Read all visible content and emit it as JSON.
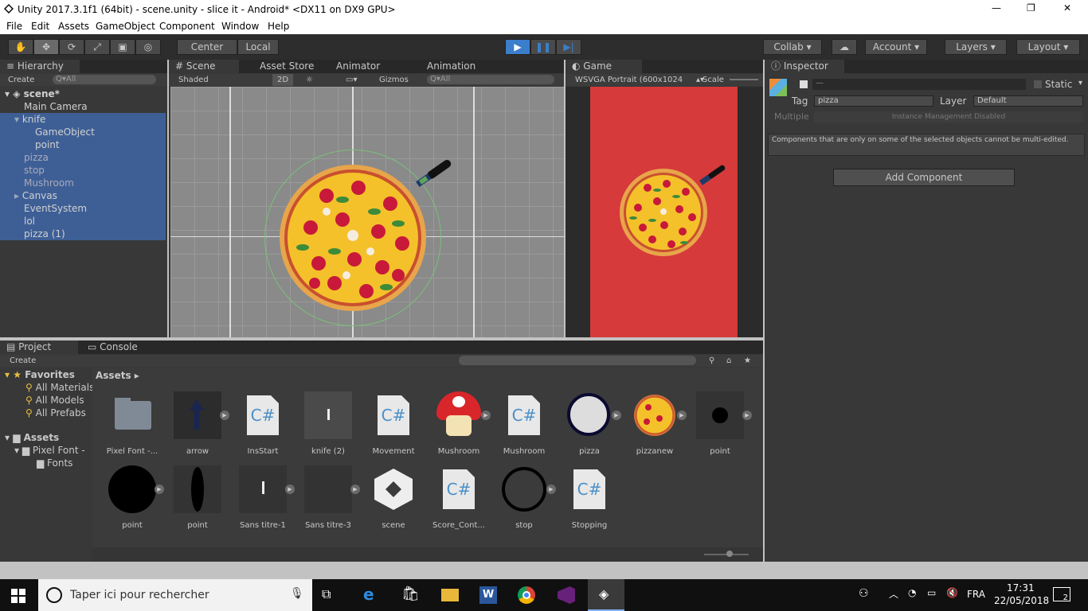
{
  "window": {
    "title": "Unity 2017.3.1f1 (64bit) - scene.unity - slice it - Android* <DX11 on DX9 GPU>",
    "minimize": "—",
    "restore": "❐",
    "close": "✕"
  },
  "menu": [
    "File",
    "Edit",
    "Assets",
    "GameObject",
    "Component",
    "Window",
    "Help"
  ],
  "toolbar": {
    "center": "Center",
    "local": "Local",
    "collab": "Collab",
    "account": "Account",
    "layers": "Layers",
    "layout": "Layout"
  },
  "hierarchy": {
    "tab": "Hierarchy",
    "create": "Create",
    "search": "Q▾All",
    "scene": "scene*",
    "items": [
      "Main Camera",
      "knife",
      "GameObject",
      "point",
      "pizza",
      "stop",
      "Mushroom",
      "Canvas",
      "EventSystem",
      "lol",
      "pizza (1)"
    ]
  },
  "scene_tabs": [
    "Scene",
    "Asset Store",
    "Animator",
    "Animation"
  ],
  "scene_bar": {
    "shaded": "Shaded",
    "mode2d": "2D",
    "gizmos": "Gizmos",
    "search": "Q▾All"
  },
  "game": {
    "tab": "Game",
    "resolution": "WSVGA Portrait (600x1024",
    "scale": "Scale"
  },
  "inspector": {
    "tab": "Inspector",
    "name": "—",
    "static": "Static",
    "tag_label": "Tag",
    "tag_value": "pizza",
    "layer_label": "Layer",
    "layer_value": "Default",
    "multiple": "Multiple",
    "instance": "Instance Management Disabled",
    "note": "Components that are only on some of the selected objects cannot be multi-edited.",
    "add": "Add Component"
  },
  "bottom_tabs": [
    "Project",
    "Console"
  ],
  "project": {
    "create": "Create",
    "favorites": "Favorites",
    "fav_items": [
      "All Materials",
      "All Models",
      "All Prefabs"
    ],
    "assets": "Assets",
    "tree": [
      "Pixel Font -",
      "Fonts"
    ],
    "breadcrumb": "Assets ▸",
    "assets_row1": [
      "Pixel Font -...",
      "arrow",
      "InsStart",
      "knife (2)",
      "Movement",
      "Mushroom",
      "Mushroom",
      "pizza",
      "pizzanew",
      "point"
    ],
    "assets_row2": [
      "point",
      "point",
      "Sans titre-1",
      "Sans titre-3",
      "scene",
      "Score_Cont...",
      "stop",
      "Stopping"
    ]
  },
  "taskbar": {
    "search": "Taper ici pour rechercher",
    "lang": "FRA",
    "time": "17:31",
    "date": "22/05/2018",
    "notif": "2"
  },
  "colors": {
    "selection": "#3e5f96",
    "game_bg": "#d63a3a",
    "play": "#3b7ecb"
  }
}
